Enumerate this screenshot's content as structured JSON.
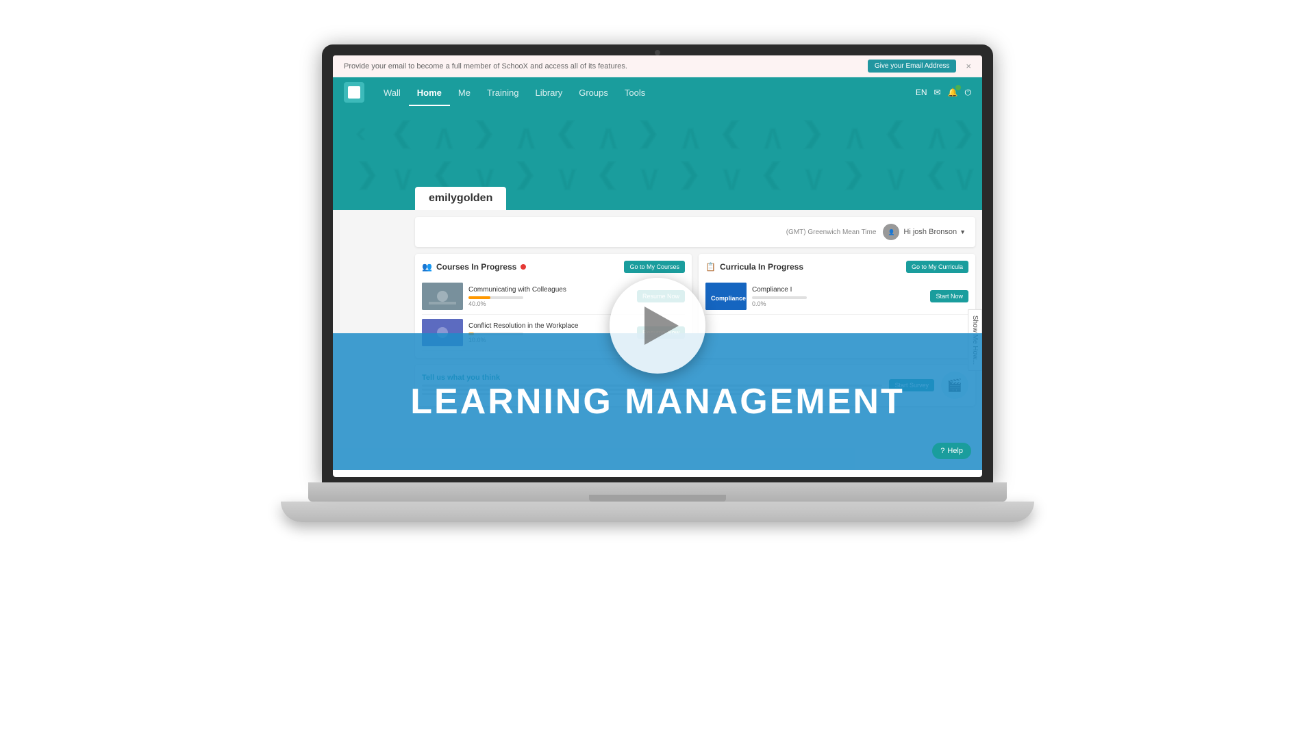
{
  "notification": {
    "message": "Provide your email to become a full member of SchooX and access all of its features.",
    "button_label": "Give your Email Address",
    "close_label": "×"
  },
  "nav": {
    "links": [
      {
        "label": "Wall",
        "active": false
      },
      {
        "label": "Home",
        "active": true
      },
      {
        "label": "Me",
        "active": false
      },
      {
        "label": "Training",
        "active": false
      },
      {
        "label": "Library",
        "active": false
      },
      {
        "label": "Groups",
        "active": false
      },
      {
        "label": "Tools",
        "active": false
      }
    ],
    "lang": "EN"
  },
  "hero": {
    "username": "emilygolden"
  },
  "greeting": {
    "timezone": "(GMT) Greenwich Mean Time",
    "message": "Hi josh Bronson"
  },
  "courses_section": {
    "title": "Courses In Progress",
    "go_to_label": "Go to My Courses",
    "courses": [
      {
        "name": "Communicating with Colleagues",
        "progress": 40,
        "progress_text": "40.0%",
        "button_label": "Resume Now"
      },
      {
        "name": "Conflict Resolution in the Workplace",
        "progress": 10,
        "progress_text": "10.0%",
        "button_label": "Resume Now"
      }
    ]
  },
  "curricula_section": {
    "title": "Curricula In Progress",
    "go_to_label": "Go to My Curricula",
    "items": [
      {
        "name": "Compliance I",
        "progress": 0,
        "progress_text": "0.0%",
        "button_label": "Start Now"
      }
    ]
  },
  "survey": {
    "title": "Tell us what you think",
    "description": "Help us improve by sharing your experience",
    "button_label": "Start Survey"
  },
  "video": {
    "play_label": "Play",
    "main_text": "LEARNING MANAGEMENT"
  },
  "show_me_how": {
    "label": "Show Me How..."
  },
  "help": {
    "label": "Help"
  }
}
